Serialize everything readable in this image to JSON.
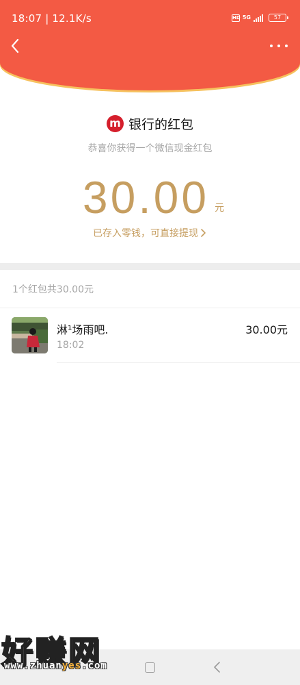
{
  "status_bar": {
    "time": "18:07 | 12.1K/s",
    "hd": "HD",
    "network": "5G",
    "battery": "57"
  },
  "header": {
    "back_icon": "chevron-left-icon",
    "more_icon": "more-dots-icon",
    "background_color": "#f35a44"
  },
  "red_packet": {
    "sender_logo": "m",
    "sender_name": "银行的红包",
    "blessing": "恭喜你获得一个微信现金红包",
    "amount": "30.00",
    "unit": "元",
    "stored_text": "已存入零钱，可直接提现",
    "amount_color": "#c69e60"
  },
  "summary": "1个红包共30.00元",
  "records": [
    {
      "name": "淋¹场雨吧.",
      "time": "18:02",
      "amount": "30.00元"
    }
  ],
  "watermark": {
    "text": "好赚网",
    "url_prefix": "www.zhuan",
    "url_highlight": "yes",
    "url_suffix": ".com"
  }
}
